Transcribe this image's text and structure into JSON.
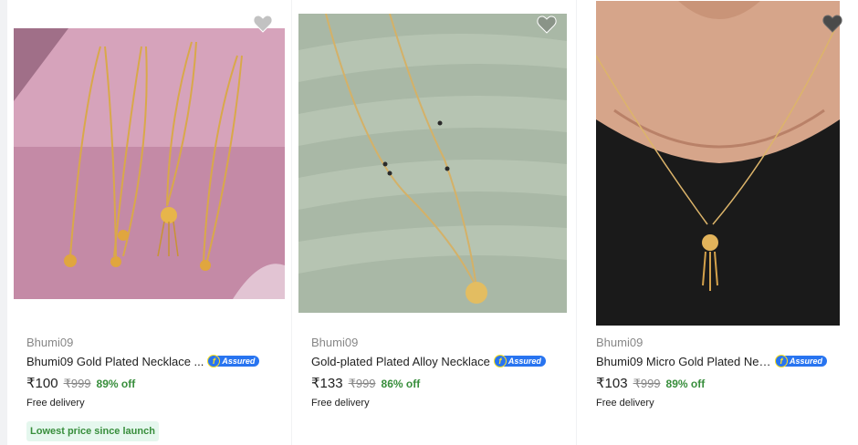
{
  "products": [
    {
      "brand": "Bhumi09",
      "title": "Bhumi09 Gold Plated Necklace ...",
      "assured_mark": "f",
      "assured_label": "Assured",
      "price": "₹100",
      "mrp": "₹999",
      "discount": "89% off",
      "delivery": "Free delivery",
      "tag": "Lowest price since launch"
    },
    {
      "brand": "Bhumi09",
      "title": "Gold-plated Plated Alloy Necklace",
      "assured_mark": "f",
      "assured_label": "Assured",
      "price": "₹133",
      "mrp": "₹999",
      "discount": "86% off",
      "delivery": "Free delivery"
    },
    {
      "brand": "Bhumi09",
      "title": "Bhumi09 Micro Gold Plated Nec...",
      "assured_mark": "f",
      "assured_label": "Assured",
      "price": "₹103",
      "mrp": "₹999",
      "discount": "89% off",
      "delivery": "Free delivery"
    }
  ],
  "colors": {
    "assured_blue": "#2874f0",
    "assured_yellow": "#ffe11b",
    "discount_green": "#388e3c",
    "tag_bg": "#e5f7ee",
    "muted_text": "#878787"
  },
  "icons": {
    "wishlist": "heart-icon",
    "assured": "flipkart-assured-badge"
  }
}
